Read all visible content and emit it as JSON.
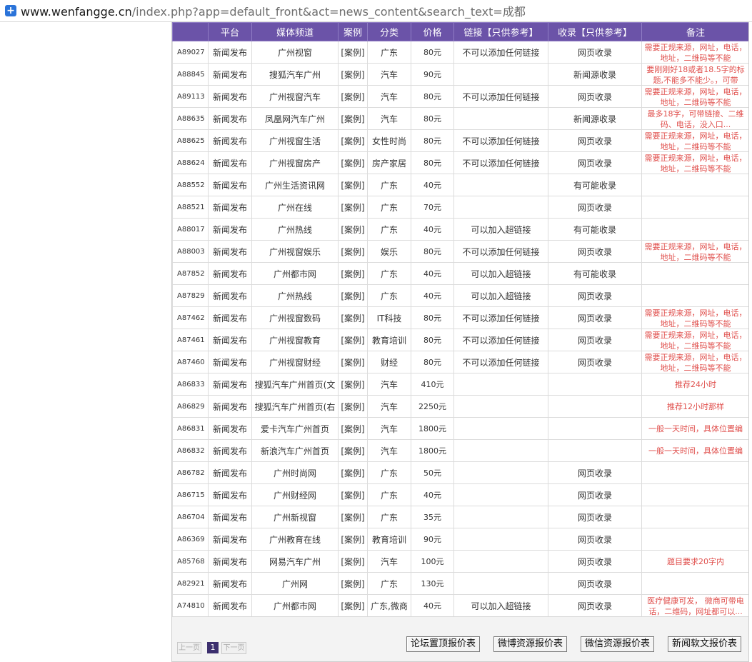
{
  "browser": {
    "url_host": "www.wenfangge.cn",
    "url_path": "/index.php?app=default_front&act=news_content&search_text=成都"
  },
  "table": {
    "headers": [
      "",
      "平台",
      "媒体频道",
      "案例",
      "分类",
      "价格",
      "链接【只供参考】",
      "收录【只供参考】",
      "备注"
    ],
    "rows": [
      [
        "A89027",
        "新闻发布",
        "广州视窗",
        "[案例]",
        "广东",
        "80元",
        "不可以添加任何链接",
        "网页收录",
        "需要正规来源，网址，电话，地址，二维码等不能"
      ],
      [
        "A88845",
        "新闻发布",
        "搜狐汽车广州",
        "[案例]",
        "汽车",
        "90元",
        "",
        "新闻源收录",
        "要刚刚好18或者18.5字的标题,不能多不能少。，可带"
      ],
      [
        "A89113",
        "新闻发布",
        "广州视窗汽车",
        "[案例]",
        "汽车",
        "80元",
        "不可以添加任何链接",
        "网页收录",
        "需要正规来源，网址，电话，地址，二维码等不能"
      ],
      [
        "A88635",
        "新闻发布",
        "凤凰网汽车广州",
        "[案例]",
        "汽车",
        "80元",
        "",
        "新闻源收录",
        "最多18字，可带链接、二维码、电话，没入口..."
      ],
      [
        "A88625",
        "新闻发布",
        "广州视窗生活",
        "[案例]",
        "女性时尚",
        "80元",
        "不可以添加任何链接",
        "网页收录",
        "需要正规来源，网址，电话，地址，二维码等不能"
      ],
      [
        "A88624",
        "新闻发布",
        "广州视窗房产",
        "[案例]",
        "房产家居",
        "80元",
        "不可以添加任何链接",
        "网页收录",
        "需要正规来源，网址，电话，地址，二维码等不能"
      ],
      [
        "A88552",
        "新闻发布",
        "广州生活资讯网",
        "[案例]",
        "广东",
        "40元",
        "",
        "有可能收录",
        ""
      ],
      [
        "A88521",
        "新闻发布",
        "广州在线",
        "[案例]",
        "广东",
        "70元",
        "",
        "网页收录",
        ""
      ],
      [
        "A88017",
        "新闻发布",
        "广州热线",
        "[案例]",
        "广东",
        "40元",
        "可以加入超链接",
        "有可能收录",
        ""
      ],
      [
        "A88003",
        "新闻发布",
        "广州视窗娱乐",
        "[案例]",
        "娱乐",
        "80元",
        "不可以添加任何链接",
        "网页收录",
        "需要正规来源，网址，电话，地址，二维码等不能"
      ],
      [
        "A87852",
        "新闻发布",
        "广州都市网",
        "[案例]",
        "广东",
        "40元",
        "可以加入超链接",
        "有可能收录",
        ""
      ],
      [
        "A87829",
        "新闻发布",
        "广州热线",
        "[案例]",
        "广东",
        "40元",
        "可以加入超链接",
        "网页收录",
        ""
      ],
      [
        "A87462",
        "新闻发布",
        "广州视窗数码",
        "[案例]",
        "IT科技",
        "80元",
        "不可以添加任何链接",
        "网页收录",
        "需要正规来源，网址，电话，地址，二维码等不能"
      ],
      [
        "A87461",
        "新闻发布",
        "广州视窗教育",
        "[案例]",
        "教育培训",
        "80元",
        "不可以添加任何链接",
        "网页收录",
        "需要正规来源，网址，电话，地址，二维码等不能"
      ],
      [
        "A87460",
        "新闻发布",
        "广州视窗财经",
        "[案例]",
        "财经",
        "80元",
        "不可以添加任何链接",
        "网页收录",
        "需要正规来源，网址，电话，地址，二维码等不能"
      ],
      [
        "A86833",
        "新闻发布",
        "搜狐汽车广州首页(文",
        "[案例]",
        "汽车",
        "410元",
        "",
        "",
        "推荐24小时"
      ],
      [
        "A86829",
        "新闻发布",
        "搜狐汽车广州首页(右",
        "[案例]",
        "汽车",
        "2250元",
        "",
        "",
        "推荐12小时那样"
      ],
      [
        "A86831",
        "新闻发布",
        "爱卡汽车广州首页",
        "[案例]",
        "汽车",
        "1800元",
        "",
        "",
        "一般一天时间，具体位置编"
      ],
      [
        "A86832",
        "新闻发布",
        "新浪汽车广州首页",
        "[案例]",
        "汽车",
        "1800元",
        "",
        "",
        "一般一天时间，具体位置编"
      ],
      [
        "A86782",
        "新闻发布",
        "广州时尚网",
        "[案例]",
        "广东",
        "50元",
        "",
        "网页收录",
        ""
      ],
      [
        "A86715",
        "新闻发布",
        "广州财经网",
        "[案例]",
        "广东",
        "40元",
        "",
        "网页收录",
        ""
      ],
      [
        "A86704",
        "新闻发布",
        "广州新视窗",
        "[案例]",
        "广东",
        "35元",
        "",
        "网页收录",
        ""
      ],
      [
        "A86369",
        "新闻发布",
        "广州教育在线",
        "[案例]",
        "教育培训",
        "90元",
        "",
        "网页收录",
        ""
      ],
      [
        "A85768",
        "新闻发布",
        "网易汽车广州",
        "[案例]",
        "汽车",
        "100元",
        "",
        "网页收录",
        "题目要求20字内"
      ],
      [
        "A82921",
        "新闻发布",
        "广州网",
        "[案例]",
        "广东",
        "130元",
        "",
        "网页收录",
        ""
      ],
      [
        "A74810",
        "新闻发布",
        "广州都市网",
        "[案例]",
        "广东,微商",
        "40元",
        "可以加入超链接",
        "网页收录",
        "医疗健康可发， 微商可带电话，二维码，网址都可以..."
      ]
    ]
  },
  "pager": {
    "prev_label": "上一页",
    "current_page": "1",
    "next_label": "下一页"
  },
  "buttons": {
    "forum": "论坛置顶报价表",
    "weibo": "微博资源报价表",
    "weixin": "微信资源报价表",
    "news": "新闻软文报价表"
  },
  "colors": {
    "header_bg": "#6b53a8",
    "note_text": "#e0504d",
    "current_page_bg": "#3c2f6e"
  }
}
